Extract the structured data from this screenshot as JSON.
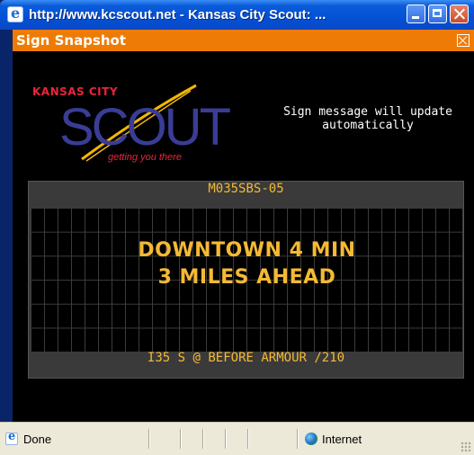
{
  "window": {
    "title": "http://www.kcscout.net - Kansas City Scout: ..."
  },
  "panel": {
    "header": "Sign Snapshot"
  },
  "logo": {
    "top_text": "KANSAS CITY",
    "main_text": "SCOUT",
    "tagline": "getting you there"
  },
  "info": {
    "line1": "Sign message will update",
    "line2": "automatically"
  },
  "sign": {
    "id": "M035SBS-05",
    "message_line1": "DOWNTOWN 4 MIN",
    "message_line2": "3 MILES AHEAD",
    "location": "I35 S @ BEFORE ARMOUR /210"
  },
  "statusbar": {
    "status": "Done",
    "zone": "Internet"
  },
  "colors": {
    "panel_header": "#ee7b05",
    "sign_text": "#f5b934",
    "logo_red": "#e8263b",
    "logo_blue": "#3a3d96",
    "logo_swoosh": "#f2b705"
  },
  "icons": [
    "ie-icon",
    "minimize-icon",
    "maximize-icon",
    "close-icon",
    "panel-close-icon",
    "globe-icon",
    "resize-grip-icon"
  ]
}
